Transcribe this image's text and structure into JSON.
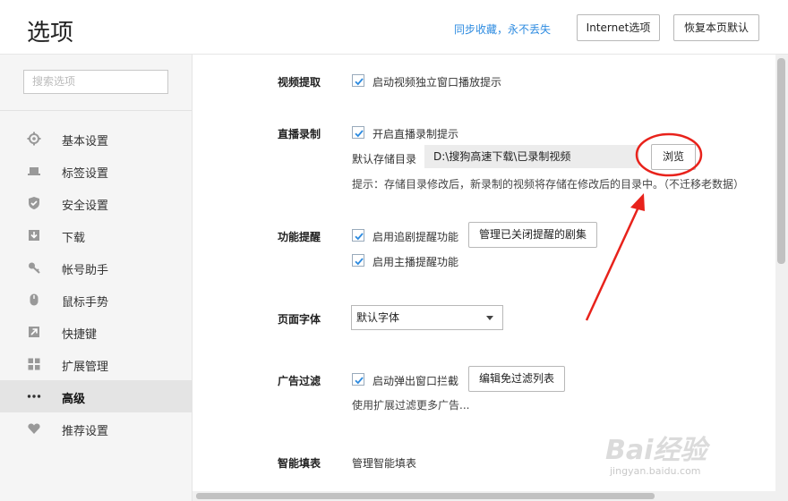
{
  "header": {
    "title": "选项",
    "sync_link": "同步收藏，永不丢失",
    "internet_options": "Internet选项",
    "restore_default": "恢复本页默认"
  },
  "sidebar": {
    "search_placeholder": "搜索选项",
    "items": [
      {
        "label": "基本设置",
        "icon": "gear-icon"
      },
      {
        "label": "标签设置",
        "icon": "laptop-icon"
      },
      {
        "label": "安全设置",
        "icon": "shield-icon"
      },
      {
        "label": "下载",
        "icon": "download-icon"
      },
      {
        "label": "帐号助手",
        "icon": "key-icon"
      },
      {
        "label": "鼠标手势",
        "icon": "mouse-icon"
      },
      {
        "label": "快捷键",
        "icon": "shortcut-arrow-icon"
      },
      {
        "label": "扩展管理",
        "icon": "grid-icon"
      },
      {
        "label": "高级",
        "icon": "more-dots-icon",
        "active": true
      },
      {
        "label": "推荐设置",
        "icon": "heart-icon"
      }
    ]
  },
  "main": {
    "video": {
      "heading": "视频提取",
      "checkbox_label": "启动视频独立窗口播放提示",
      "checked": true
    },
    "live": {
      "heading": "直播录制",
      "checkbox_label": "开启直播录制提示",
      "checked": true,
      "dir_label": "默认存储目录",
      "dir_value": "D:\\搜狗高速下载\\已录制视频",
      "browse_label": "浏览",
      "hint": "提示：存储目录修改后，新录制的视频将存储在修改后的目录中。（不迁移老数据）"
    },
    "reminder": {
      "heading": "功能提醒",
      "option1": "启用追剧提醒功能",
      "option1_checked": true,
      "manage_button": "管理已关闭提醒的剧集",
      "option2": "启用主播提醒功能",
      "option2_checked": true
    },
    "font": {
      "heading": "页面字体",
      "selected": "默认字体"
    },
    "adblock": {
      "heading": "广告过滤",
      "checkbox_label": "启动弹出窗口拦截",
      "checked": true,
      "edit_button": "编辑免过滤列表",
      "note": "使用扩展过滤更多广告..."
    },
    "autofill": {
      "heading": "智能填表",
      "link": "管理智能填表"
    }
  },
  "watermark": {
    "brand": "Bai经验",
    "url": "jingyan.baidu.com"
  },
  "colors": {
    "accent": "#2d8be0",
    "checkbox_tick": "#2d8be0",
    "annotation": "#e8221b"
  }
}
